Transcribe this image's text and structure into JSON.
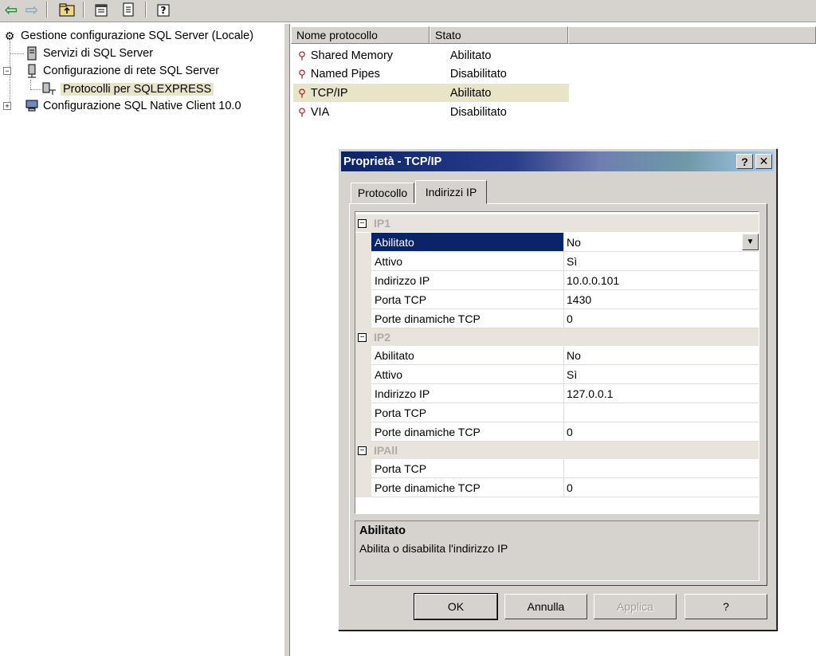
{
  "toolbar": {
    "buttons": [
      "back-icon",
      "forward-icon",
      "up-folder-icon",
      "properties-icon",
      "export-icon",
      "help-icon"
    ]
  },
  "tree": {
    "root": "Gestione configurazione SQL Server (Locale)",
    "services": "Servizi di SQL Server",
    "network_config": "Configurazione di rete SQL Server",
    "protocols": "Protocolli per SQLEXPRESS",
    "native_client": "Configurazione SQL Native Client 10.0"
  },
  "list": {
    "columns": [
      "Nome protocollo",
      "Stato"
    ],
    "rows": [
      {
        "name": "Shared Memory",
        "state": "Abilitato"
      },
      {
        "name": "Named Pipes",
        "state": "Disabilitato"
      },
      {
        "name": "TCP/IP",
        "state": "Abilitato"
      },
      {
        "name": "VIA",
        "state": "Disabilitato"
      }
    ]
  },
  "dialog": {
    "title": "Proprietà - TCP/IP",
    "help_button": "?",
    "close_button": "✕",
    "tabs": [
      "Protocollo",
      "Indirizzi IP"
    ],
    "active_tab": "Indirizzi IP",
    "sections": [
      {
        "label": "IP1",
        "rows": [
          {
            "name": "Abilitato",
            "value": "No"
          },
          {
            "name": "Attivo",
            "value": "Sì"
          },
          {
            "name": "Indirizzo IP",
            "value": "10.0.0.101"
          },
          {
            "name": "Porta TCP",
            "value": "1430"
          },
          {
            "name": "Porte dinamiche TCP",
            "value": "0"
          }
        ]
      },
      {
        "label": "IP2",
        "rows": [
          {
            "name": "Abilitato",
            "value": "No"
          },
          {
            "name": "Attivo",
            "value": "Sì"
          },
          {
            "name": "Indirizzo IP",
            "value": "127.0.0.1"
          },
          {
            "name": "Porta TCP",
            "value": ""
          },
          {
            "name": "Porte dinamiche TCP",
            "value": "0"
          }
        ]
      },
      {
        "label": "IPAll",
        "rows": [
          {
            "name": "Porta TCP",
            "value": ""
          },
          {
            "name": "Porte dinamiche TCP",
            "value": "0"
          }
        ]
      }
    ],
    "description": {
      "title": "Abilitato",
      "text": "Abilita o disabilita l'indirizzo IP"
    },
    "buttons": {
      "ok": "OK",
      "cancel": "Annulla",
      "apply": "Applica",
      "help": "?"
    }
  },
  "colors": {
    "title_bar": "#0a246a",
    "selection": "#0a246a",
    "face": "#d6d3ce",
    "tree_selection": "#e8e4c8"
  }
}
